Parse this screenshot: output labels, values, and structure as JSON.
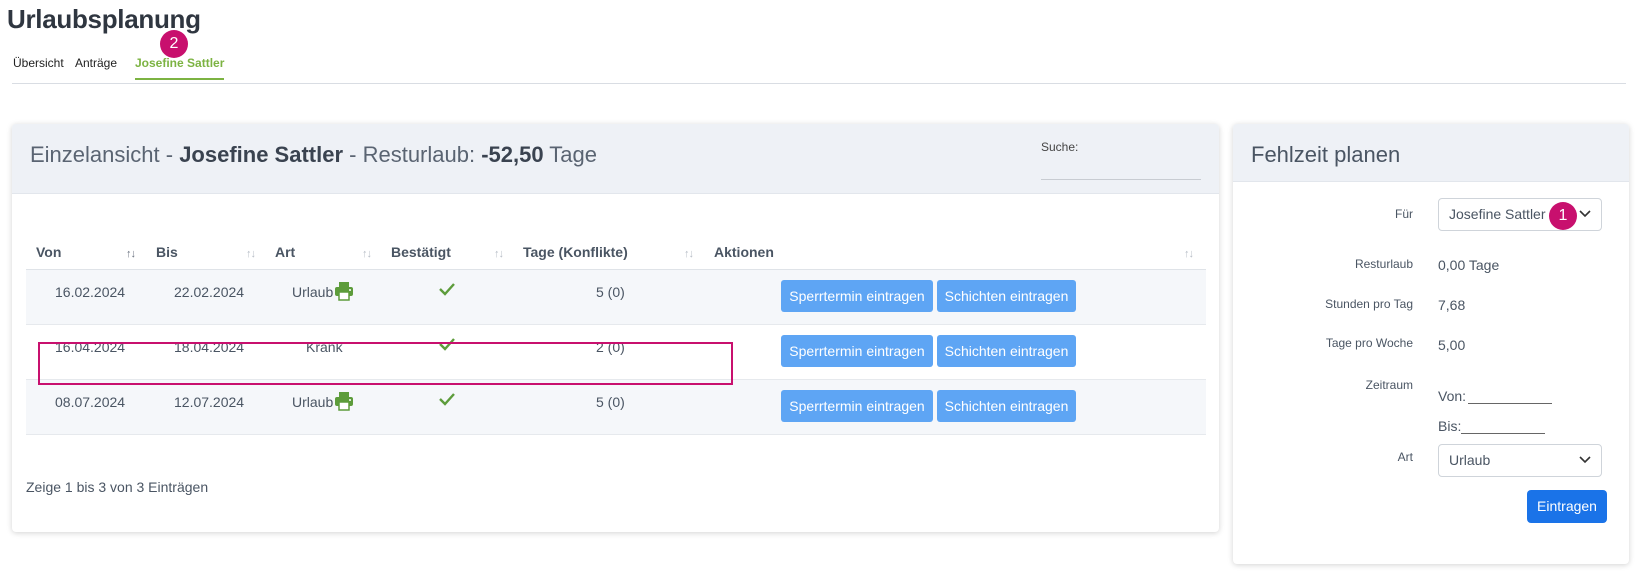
{
  "page": {
    "title": "Urlaubsplanung"
  },
  "tabs": [
    {
      "label": "Übersicht"
    },
    {
      "label": "Anträge"
    },
    {
      "label": "Josefine Sattler"
    }
  ],
  "badges": {
    "tab_badge": "2",
    "select_badge": "1"
  },
  "main": {
    "title_prefix": "Einzelansicht - ",
    "title_name": "Josefine Sattler",
    "title_middle": " - Resturlaub: ",
    "title_value": "-52,50",
    "title_suffix": " Tage",
    "search_label": "Suche:",
    "search_value": "",
    "columns": [
      "Von",
      "Bis",
      "Art",
      "Bestätigt",
      "Tage (Konflikte)",
      "Aktionen"
    ],
    "rows": [
      {
        "von": "16.02.2024",
        "bis": "22.02.2024",
        "art": "Urlaub",
        "printer": true,
        "confirmed": true,
        "tage": "5 (0)",
        "btn1": "Sperrtermin eintragen",
        "btn2": "Schichten eintragen"
      },
      {
        "von": "16.04.2024",
        "bis": "18.04.2024",
        "art": "Krank",
        "printer": false,
        "confirmed": true,
        "tage": "2 (0)",
        "btn1": "Sperrtermin eintragen",
        "btn2": "Schichten eintragen"
      },
      {
        "von": "08.07.2024",
        "bis": "12.07.2024",
        "art": "Urlaub",
        "printer": true,
        "confirmed": true,
        "tage": "5 (0)",
        "btn1": "Sperrtermin eintragen",
        "btn2": "Schichten eintragen"
      }
    ],
    "info": "Zeige 1 bis 3 von 3 Einträgen"
  },
  "side": {
    "title": "Fehlzeit planen",
    "fuer_label": "Für",
    "fuer_value": "Josefine Sattler",
    "resturlaub_label": "Resturlaub",
    "resturlaub_value": "0,00 Tage",
    "stunden_label": "Stunden pro Tag",
    "stunden_value": "7,68",
    "tage_label": "Tage pro Woche",
    "tage_value": "5,00",
    "zeitraum_label": "Zeitraum",
    "von_label": "Von:",
    "bis_label": "Bis:",
    "art_label": "Art",
    "art_value": "Urlaub",
    "submit": "Eintragen"
  },
  "colors": {
    "accent_green": "#7cb342",
    "button_blue": "#5ea5f4",
    "primary_blue": "#1a73e8",
    "highlight_magenta": "#c8106e"
  },
  "icons": [
    "printer-icon",
    "check-icon",
    "chevron-down-icon",
    "sort-icon"
  ]
}
